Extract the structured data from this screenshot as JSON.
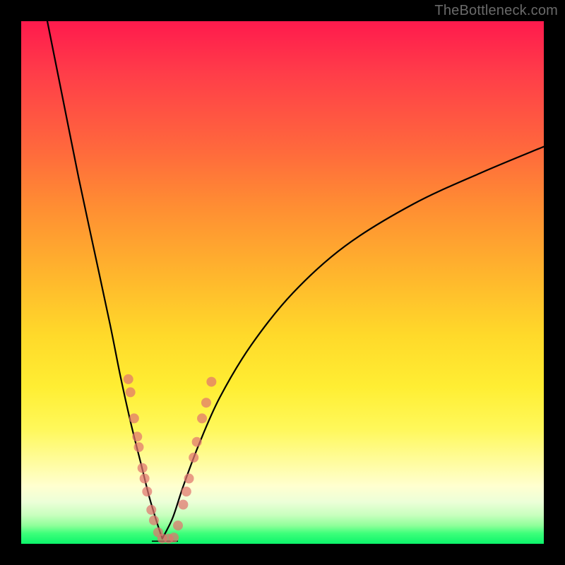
{
  "watermark": "TheBottleneck.com",
  "colors": {
    "frame": "#000000",
    "curve": "#000000",
    "marker": "#e0746e",
    "gradient_top": "#ff1a4d",
    "gradient_bottom": "#0cf46b"
  },
  "chart_data": {
    "type": "line",
    "title": "",
    "xlabel": "",
    "ylabel": "",
    "xlim": [
      0,
      100
    ],
    "ylim": [
      0,
      100
    ],
    "notes": "Bottleneck-style V curve. y ≈ 100 is worst (red), y ≈ 0 is best (green). Minimum around x ≈ 27.",
    "series": [
      {
        "name": "left-branch",
        "x": [
          5,
          8,
          11,
          14,
          17,
          19,
          21,
          23,
          24.5,
          26,
          27
        ],
        "values": [
          100,
          85,
          70,
          56,
          42,
          32,
          23,
          15,
          9,
          4,
          1
        ]
      },
      {
        "name": "right-branch",
        "x": [
          27,
          29,
          31,
          34,
          38,
          44,
          52,
          62,
          75,
          88,
          100
        ],
        "values": [
          1,
          5,
          11,
          19,
          28,
          38,
          48,
          57,
          65,
          71,
          76
        ]
      },
      {
        "name": "floor-line",
        "x": [
          25,
          30
        ],
        "values": [
          0.5,
          0.5
        ]
      }
    ],
    "markers": {
      "name": "sample-points",
      "points": [
        {
          "x": 20.5,
          "y": 31.5
        },
        {
          "x": 20.9,
          "y": 29.0
        },
        {
          "x": 21.6,
          "y": 24.0
        },
        {
          "x": 22.2,
          "y": 20.5
        },
        {
          "x": 22.5,
          "y": 18.5
        },
        {
          "x": 23.2,
          "y": 14.5
        },
        {
          "x": 23.6,
          "y": 12.5
        },
        {
          "x": 24.1,
          "y": 10.0
        },
        {
          "x": 24.9,
          "y": 6.5
        },
        {
          "x": 25.4,
          "y": 4.5
        },
        {
          "x": 26.2,
          "y": 2.2
        },
        {
          "x": 27.0,
          "y": 1.0
        },
        {
          "x": 28.2,
          "y": 1.0
        },
        {
          "x": 29.2,
          "y": 1.2
        },
        {
          "x": 30.0,
          "y": 3.5
        },
        {
          "x": 31.0,
          "y": 7.5
        },
        {
          "x": 31.6,
          "y": 10.0
        },
        {
          "x": 32.1,
          "y": 12.5
        },
        {
          "x": 33.0,
          "y": 16.5
        },
        {
          "x": 33.6,
          "y": 19.5
        },
        {
          "x": 34.6,
          "y": 24.0
        },
        {
          "x": 35.4,
          "y": 27.0
        },
        {
          "x": 36.4,
          "y": 31.0
        }
      ]
    }
  }
}
